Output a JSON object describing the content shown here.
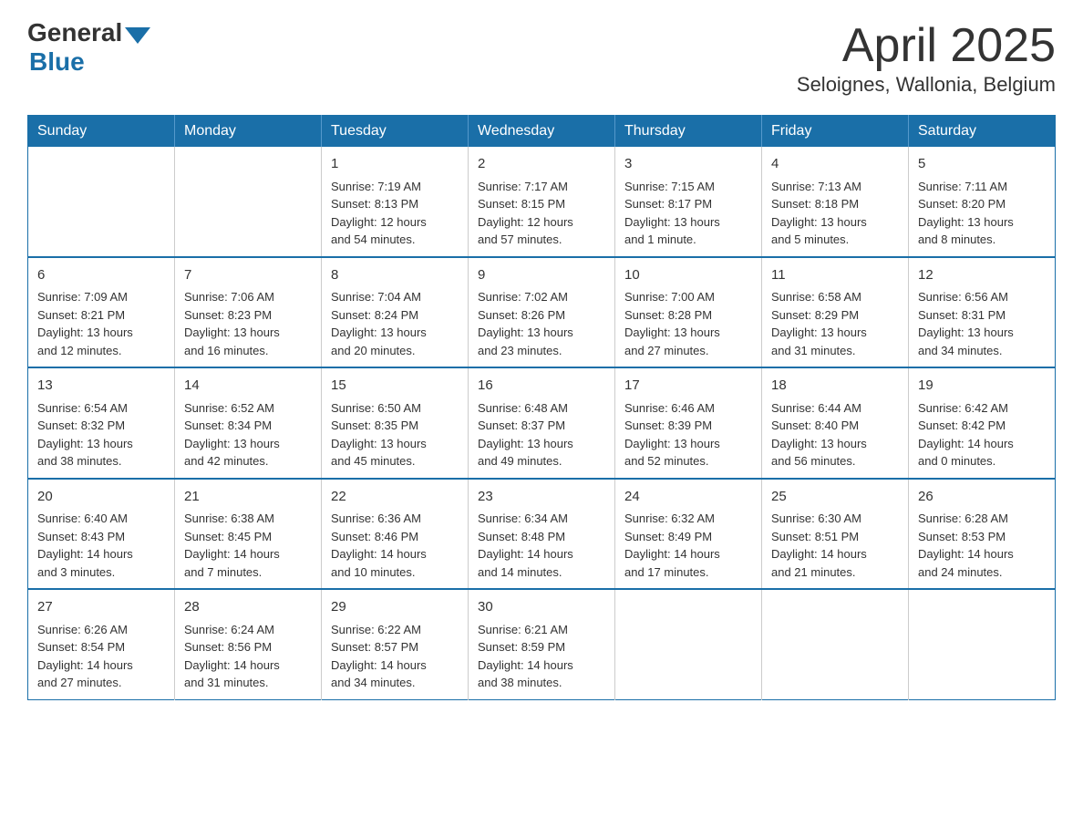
{
  "header": {
    "logo_general": "General",
    "logo_blue": "Blue",
    "month_year": "April 2025",
    "location": "Seloignes, Wallonia, Belgium"
  },
  "calendar": {
    "days_of_week": [
      "Sunday",
      "Monday",
      "Tuesday",
      "Wednesday",
      "Thursday",
      "Friday",
      "Saturday"
    ],
    "weeks": [
      [
        {
          "day": "",
          "info": ""
        },
        {
          "day": "",
          "info": ""
        },
        {
          "day": "1",
          "info": "Sunrise: 7:19 AM\nSunset: 8:13 PM\nDaylight: 12 hours\nand 54 minutes."
        },
        {
          "day": "2",
          "info": "Sunrise: 7:17 AM\nSunset: 8:15 PM\nDaylight: 12 hours\nand 57 minutes."
        },
        {
          "day": "3",
          "info": "Sunrise: 7:15 AM\nSunset: 8:17 PM\nDaylight: 13 hours\nand 1 minute."
        },
        {
          "day": "4",
          "info": "Sunrise: 7:13 AM\nSunset: 8:18 PM\nDaylight: 13 hours\nand 5 minutes."
        },
        {
          "day": "5",
          "info": "Sunrise: 7:11 AM\nSunset: 8:20 PM\nDaylight: 13 hours\nand 8 minutes."
        }
      ],
      [
        {
          "day": "6",
          "info": "Sunrise: 7:09 AM\nSunset: 8:21 PM\nDaylight: 13 hours\nand 12 minutes."
        },
        {
          "day": "7",
          "info": "Sunrise: 7:06 AM\nSunset: 8:23 PM\nDaylight: 13 hours\nand 16 minutes."
        },
        {
          "day": "8",
          "info": "Sunrise: 7:04 AM\nSunset: 8:24 PM\nDaylight: 13 hours\nand 20 minutes."
        },
        {
          "day": "9",
          "info": "Sunrise: 7:02 AM\nSunset: 8:26 PM\nDaylight: 13 hours\nand 23 minutes."
        },
        {
          "day": "10",
          "info": "Sunrise: 7:00 AM\nSunset: 8:28 PM\nDaylight: 13 hours\nand 27 minutes."
        },
        {
          "day": "11",
          "info": "Sunrise: 6:58 AM\nSunset: 8:29 PM\nDaylight: 13 hours\nand 31 minutes."
        },
        {
          "day": "12",
          "info": "Sunrise: 6:56 AM\nSunset: 8:31 PM\nDaylight: 13 hours\nand 34 minutes."
        }
      ],
      [
        {
          "day": "13",
          "info": "Sunrise: 6:54 AM\nSunset: 8:32 PM\nDaylight: 13 hours\nand 38 minutes."
        },
        {
          "day": "14",
          "info": "Sunrise: 6:52 AM\nSunset: 8:34 PM\nDaylight: 13 hours\nand 42 minutes."
        },
        {
          "day": "15",
          "info": "Sunrise: 6:50 AM\nSunset: 8:35 PM\nDaylight: 13 hours\nand 45 minutes."
        },
        {
          "day": "16",
          "info": "Sunrise: 6:48 AM\nSunset: 8:37 PM\nDaylight: 13 hours\nand 49 minutes."
        },
        {
          "day": "17",
          "info": "Sunrise: 6:46 AM\nSunset: 8:39 PM\nDaylight: 13 hours\nand 52 minutes."
        },
        {
          "day": "18",
          "info": "Sunrise: 6:44 AM\nSunset: 8:40 PM\nDaylight: 13 hours\nand 56 minutes."
        },
        {
          "day": "19",
          "info": "Sunrise: 6:42 AM\nSunset: 8:42 PM\nDaylight: 14 hours\nand 0 minutes."
        }
      ],
      [
        {
          "day": "20",
          "info": "Sunrise: 6:40 AM\nSunset: 8:43 PM\nDaylight: 14 hours\nand 3 minutes."
        },
        {
          "day": "21",
          "info": "Sunrise: 6:38 AM\nSunset: 8:45 PM\nDaylight: 14 hours\nand 7 minutes."
        },
        {
          "day": "22",
          "info": "Sunrise: 6:36 AM\nSunset: 8:46 PM\nDaylight: 14 hours\nand 10 minutes."
        },
        {
          "day": "23",
          "info": "Sunrise: 6:34 AM\nSunset: 8:48 PM\nDaylight: 14 hours\nand 14 minutes."
        },
        {
          "day": "24",
          "info": "Sunrise: 6:32 AM\nSunset: 8:49 PM\nDaylight: 14 hours\nand 17 minutes."
        },
        {
          "day": "25",
          "info": "Sunrise: 6:30 AM\nSunset: 8:51 PM\nDaylight: 14 hours\nand 21 minutes."
        },
        {
          "day": "26",
          "info": "Sunrise: 6:28 AM\nSunset: 8:53 PM\nDaylight: 14 hours\nand 24 minutes."
        }
      ],
      [
        {
          "day": "27",
          "info": "Sunrise: 6:26 AM\nSunset: 8:54 PM\nDaylight: 14 hours\nand 27 minutes."
        },
        {
          "day": "28",
          "info": "Sunrise: 6:24 AM\nSunset: 8:56 PM\nDaylight: 14 hours\nand 31 minutes."
        },
        {
          "day": "29",
          "info": "Sunrise: 6:22 AM\nSunset: 8:57 PM\nDaylight: 14 hours\nand 34 minutes."
        },
        {
          "day": "30",
          "info": "Sunrise: 6:21 AM\nSunset: 8:59 PM\nDaylight: 14 hours\nand 38 minutes."
        },
        {
          "day": "",
          "info": ""
        },
        {
          "day": "",
          "info": ""
        },
        {
          "day": "",
          "info": ""
        }
      ]
    ]
  }
}
